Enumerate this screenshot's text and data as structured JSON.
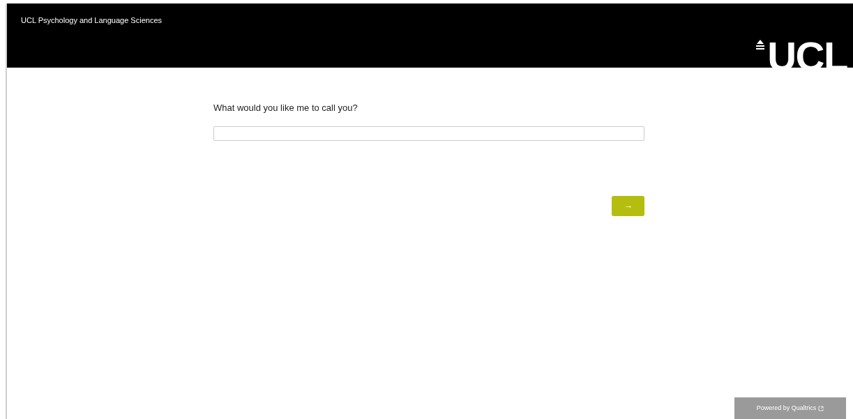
{
  "header": {
    "title": "UCL Psychology and Language Sciences",
    "logo": "UCL"
  },
  "question": {
    "text": "What would you like me to call you?"
  },
  "next_button": {
    "label": "→"
  },
  "footer": {
    "badge": "Powered by Qualtrics"
  }
}
